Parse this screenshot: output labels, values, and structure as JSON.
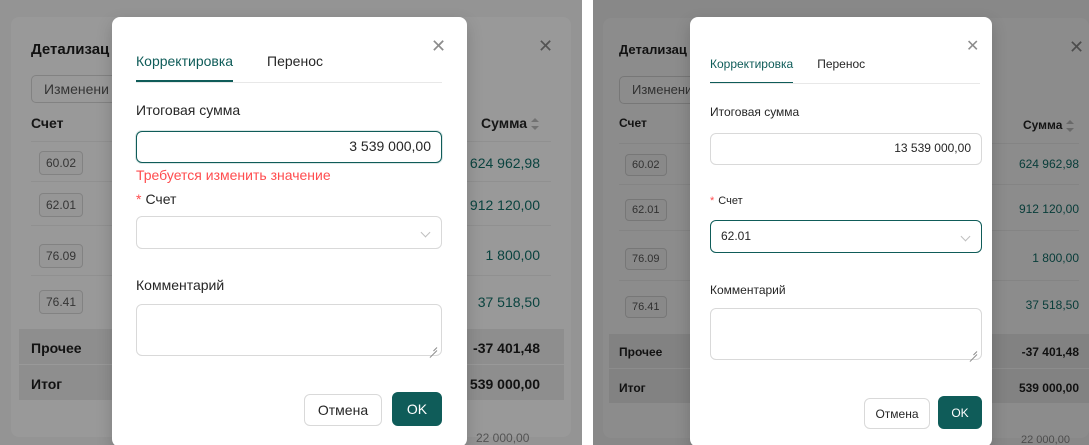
{
  "colors": {
    "accent": "#0f5c59",
    "error": "#ff4d4f",
    "value_teal": "#11706a"
  },
  "icons": {
    "close": "close-icon",
    "chevron": "chevron-down-icon",
    "sort": "sort-icon",
    "resize": "resize-handle-icon"
  },
  "background": {
    "title": "Детализац",
    "chip": "Изменени",
    "col_account": "Счет",
    "col_sum": "Сумма",
    "accounts": [
      "60.02",
      "62.01",
      "76.09",
      "76.41"
    ],
    "values": [
      "624 962,98",
      "912 120,00",
      "1 800,00",
      "37 518,50"
    ],
    "other_label": "Прочее",
    "other_value": "-37 401,48",
    "total_label": "Итог",
    "total_value": "539 000,00",
    "below_value": "22 000,00"
  },
  "left_dialog": {
    "tab_correction": "Корректировка",
    "tab_transfer": "Перенос",
    "amount_label": "Итоговая сумма",
    "amount_value": "3 539 000,00",
    "error_text": "Требуется изменить значение",
    "account_label": "Счет",
    "account_value": "",
    "comment_label": "Комментарий",
    "cancel": "Отмена",
    "ok": "OK"
  },
  "right_dialog": {
    "tab_correction": "Корректировка",
    "tab_transfer": "Перенос",
    "amount_label": "Итоговая сумма",
    "amount_value": "13 539 000,00",
    "account_label": "Счет",
    "account_value": "62.01",
    "comment_label": "Комментарий",
    "cancel": "Отмена",
    "ok": "OK"
  }
}
